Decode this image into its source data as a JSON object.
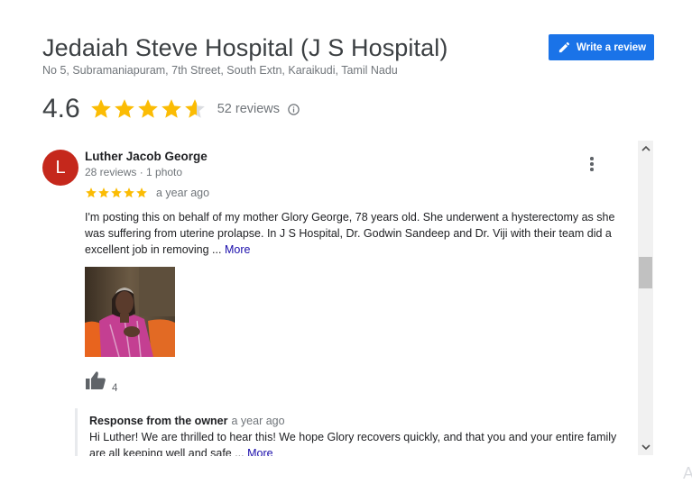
{
  "place": {
    "name": "Jedaiah Steve Hospital (J S Hospital)",
    "address": "No 5, Subramaniapuram, 7th Street, South Extn, Karaikudi, Tamil Nadu"
  },
  "write_review": {
    "label": "Write a review",
    "icon": "pencil-icon"
  },
  "summary": {
    "rating": "4.6",
    "stars_value": 4.6,
    "reviews_count": "52 reviews",
    "info_icon": "info-icon"
  },
  "review": {
    "avatar_letter": "L",
    "avatar_color": "#c5281c",
    "author": "Luther Jacob George",
    "meta": "28 reviews · 1 photo",
    "stars_value": 5,
    "time": "a year ago",
    "text": "I'm posting this on behalf of my mother Glory George, 78 years old. She underwent a hysterectomy as she was suffering from uterine prolapse. In J S Hospital, Dr. Godwin Sandeep and Dr. Viji with their team did a excellent job in removing ...",
    "more_label": "More",
    "likes": "4"
  },
  "owner_response": {
    "heading": "Response from the owner",
    "time": "a year ago",
    "text": "Hi Luther! We are thrilled to hear this! We hope Glory recovers quickly, and that you and your entire family are all keeping well and safe ...",
    "more_label": "More"
  },
  "corner_glyph": "A",
  "colors": {
    "accent": "#1a73e8",
    "star": "#fbbc04",
    "link": "#1a0dab"
  }
}
